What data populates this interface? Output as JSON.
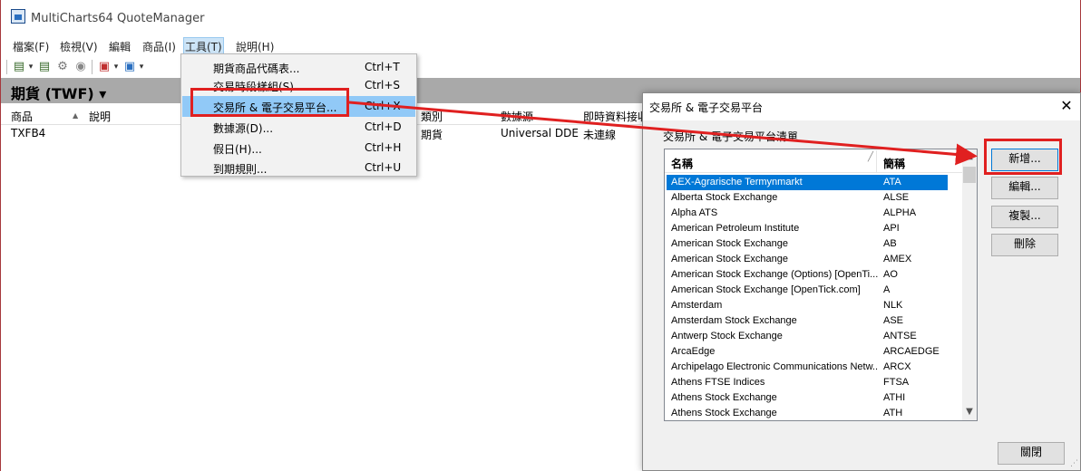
{
  "window": {
    "title": "MultiCharts64 QuoteManager"
  },
  "menubar": {
    "items": [
      "檔案(F)",
      "檢視(V)",
      "編輯",
      "商品(I)",
      "工具(T)",
      "說明(H)"
    ]
  },
  "toolbar": {
    "icons": [
      "add-symbol-icon",
      "dropdown-arrow-icon",
      "edit-symbol-icon",
      "settings-icon",
      "record-icon",
      "export-icon",
      "dropdown-arrow-icon",
      "import-icon",
      "dropdown-arrow-icon"
    ]
  },
  "tab": {
    "label": "期貨 (TWF) ▾"
  },
  "grid": {
    "headers": {
      "symbol": "商品",
      "sort_glyph": "▲",
      "description": "說明",
      "category": "類別",
      "data_source": "數據源",
      "realtime": "即時資料接收"
    },
    "row": {
      "symbol": "TXFB4",
      "category": "期貨",
      "data_source": "Universal DDE",
      "realtime": "未連線"
    }
  },
  "tools_menu": {
    "items": [
      {
        "label": "期貨商品代碼表...",
        "shortcut": "Ctrl+T"
      },
      {
        "label": "交易時段樣組(S)",
        "shortcut": "Ctrl+S"
      },
      {
        "label": "交易所 & 電子交易平台...",
        "shortcut": "Ctrl+X"
      },
      {
        "label": "數據源(D)...",
        "shortcut": "Ctrl+D"
      },
      {
        "label": "假日(H)...",
        "shortcut": "Ctrl+H"
      },
      {
        "label": "到期規則...",
        "shortcut": "Ctrl+U"
      }
    ],
    "highlighted_index": 2
  },
  "dialog": {
    "title": "交易所 & 電子交易平台",
    "close_glyph": "✕",
    "group_label": "交易所 & 電子交易平台清單",
    "columns": {
      "name": "名稱",
      "abbr": "簡稱"
    },
    "rows": [
      {
        "name": "AEX-Agrarische Termynmarkt",
        "abbr": "ATA"
      },
      {
        "name": "Alberta Stock Exchange",
        "abbr": "ALSE"
      },
      {
        "name": "Alpha ATS",
        "abbr": "ALPHA"
      },
      {
        "name": "American Petroleum Institute",
        "abbr": "API"
      },
      {
        "name": "American Stock Exchange",
        "abbr": "AB"
      },
      {
        "name": "American Stock Exchange",
        "abbr": "AMEX"
      },
      {
        "name": "American Stock Exchange (Options) [OpenTi...",
        "abbr": "AO"
      },
      {
        "name": "American Stock Exchange [OpenTick.com]",
        "abbr": "A"
      },
      {
        "name": "Amsterdam",
        "abbr": "NLK"
      },
      {
        "name": "Amsterdam Stock Exchange",
        "abbr": "ASE"
      },
      {
        "name": "Antwerp Stock Exchange",
        "abbr": "ANTSE"
      },
      {
        "name": "ArcaEdge",
        "abbr": "ARCAEDGE"
      },
      {
        "name": "Archipelago Electronic Communications Netw...",
        "abbr": "ARCX"
      },
      {
        "name": "Athens FTSE Indices",
        "abbr": "FTSA"
      },
      {
        "name": "Athens Stock Exchange",
        "abbr": "ATHI"
      },
      {
        "name": "Athens Stock Exchange",
        "abbr": "ATH"
      }
    ],
    "selected_index": 0,
    "buttons": {
      "add": "新增...",
      "edit": "編輯...",
      "copy": "複製...",
      "delete": "刪除",
      "close": "關閉"
    }
  },
  "colors": {
    "annotation_red": "#e02020",
    "selection_blue": "#0078d7",
    "menu_highlight": "#91c9f7",
    "tab_strip_gray": "#a9a9a9"
  }
}
